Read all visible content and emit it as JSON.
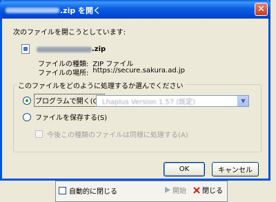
{
  "dialog": {
    "title_suffix": ".zip を開く",
    "close_glyph": "✕",
    "intro": "次のファイルを開こうとしています:",
    "file_ext": ".zip",
    "info": [
      {
        "label": "ファイルの種類:",
        "value": "ZIP ファイル"
      },
      {
        "label": "ファイルの場所:",
        "value": "https://secure.sakura.ad.jp"
      }
    ],
    "group_legend": "このファイルをどのように処理するか選んでください",
    "option_open": "プログラムで開く(O):",
    "select_value": "Lhaplus Version 1.57 (既定)",
    "option_save": "ファイルを保存する(S)",
    "remember": "今後この種類のファイルは同様に処理する(A)",
    "ok": "OK",
    "cancel": "キャンセル"
  },
  "background": {
    "auto_close": "自動的に閉じる",
    "open": "開始",
    "close": "閉じる"
  },
  "colors": {
    "title_bar": "#0054e3",
    "close_button": "#c63b1f",
    "dialog_bg": "#ece9d8"
  },
  "icons": [
    "file-icon",
    "close-icon",
    "chevron-down-icon",
    "play-icon",
    "x-icon"
  ]
}
